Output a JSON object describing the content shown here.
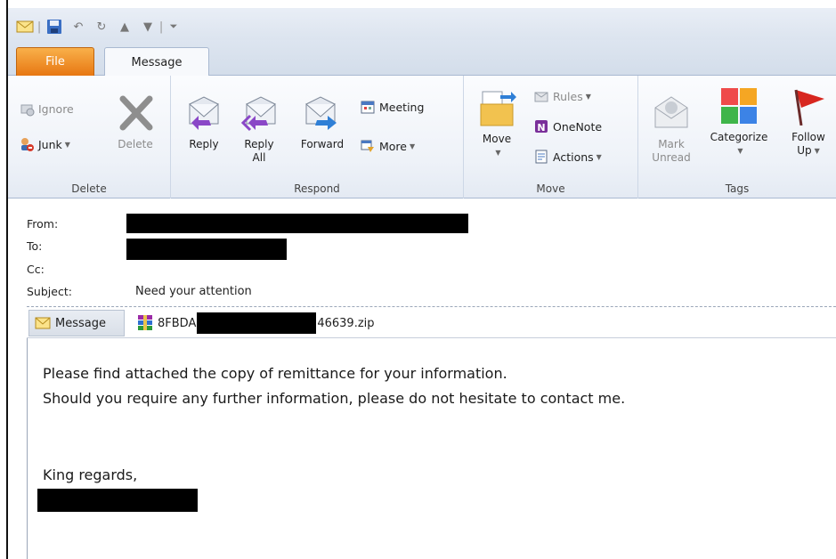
{
  "quick_access": {
    "icons": [
      "envelope-icon",
      "save-icon",
      "undo-icon",
      "redo-icon",
      "up-arrow-icon",
      "down-arrow-icon",
      "customize-icon"
    ]
  },
  "tabs": {
    "file": "File",
    "message": "Message"
  },
  "ribbon": {
    "delete_group": {
      "label": "Delete",
      "ignore": "Ignore",
      "junk": "Junk",
      "delete": "Delete"
    },
    "respond_group": {
      "label": "Respond",
      "reply": "Reply",
      "reply_all_line1": "Reply",
      "reply_all_line2": "All",
      "forward": "Forward",
      "meeting": "Meeting",
      "more": "More"
    },
    "move_group": {
      "label": "Move",
      "move": "Move",
      "rules": "Rules",
      "onenote": "OneNote",
      "actions": "Actions"
    },
    "tags_group": {
      "label": "Tags",
      "mark_unread_line1": "Mark",
      "mark_unread_line2": "Unread",
      "categorize": "Categorize",
      "follow_up_line1": "Follow",
      "follow_up_line2": "Up"
    }
  },
  "header": {
    "from_label": "From:",
    "to_label": "To:",
    "cc_label": "Cc:",
    "subject_label": "Subject:",
    "subject_value": "Need your attention"
  },
  "attachments": {
    "message_tab": "Message",
    "file_prefix": "8FBDA",
    "file_suffix": "46639.zip"
  },
  "body": {
    "line1": "Please find attached the copy of remittance for your information.",
    "line2": "Should you require any further information, please do not hesitate to contact me.",
    "closing": "King regards,"
  },
  "colors": {
    "file_tab": "#e77712",
    "ribbon_bg": "#eef2f8",
    "redaction": "#000000"
  }
}
